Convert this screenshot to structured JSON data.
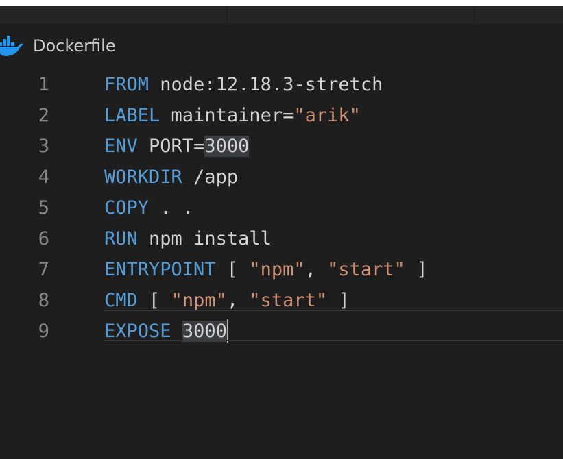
{
  "breadcrumb": {
    "file_name": "Dockerfile",
    "icon": "docker-whale-icon",
    "icon_color": "#2496ed"
  },
  "editor": {
    "lines": [
      {
        "number": "1",
        "parts": [
          {
            "t": "FROM",
            "c": "kw"
          },
          {
            "t": " node:12.18.3-stretch",
            "c": ""
          }
        ]
      },
      {
        "number": "2",
        "parts": [
          {
            "t": "LABEL",
            "c": "kw"
          },
          {
            "t": " maintainer=",
            "c": ""
          },
          {
            "t": "\"arik\"",
            "c": "str"
          }
        ]
      },
      {
        "number": "3",
        "parts": [
          {
            "t": "ENV",
            "c": "kw"
          },
          {
            "t": " PORT=",
            "c": ""
          },
          {
            "t": "3000",
            "c": "hl"
          }
        ]
      },
      {
        "number": "4",
        "parts": [
          {
            "t": "WORKDIR",
            "c": "kw"
          },
          {
            "t": " /app",
            "c": ""
          }
        ]
      },
      {
        "number": "5",
        "parts": [
          {
            "t": "COPY",
            "c": "kw"
          },
          {
            "t": " . .",
            "c": ""
          }
        ]
      },
      {
        "number": "6",
        "parts": [
          {
            "t": "RUN",
            "c": "kw"
          },
          {
            "t": " npm install",
            "c": ""
          }
        ]
      },
      {
        "number": "7",
        "parts": [
          {
            "t": "ENTRYPOINT",
            "c": "kw"
          },
          {
            "t": " [ ",
            "c": ""
          },
          {
            "t": "\"npm\"",
            "c": "str"
          },
          {
            "t": ", ",
            "c": ""
          },
          {
            "t": "\"start\"",
            "c": "str"
          },
          {
            "t": " ]",
            "c": ""
          }
        ]
      },
      {
        "number": "8",
        "parts": [
          {
            "t": "CMD",
            "c": "kw"
          },
          {
            "t": " [ ",
            "c": ""
          },
          {
            "t": "\"npm\"",
            "c": "str"
          },
          {
            "t": ", ",
            "c": ""
          },
          {
            "t": "\"start\"",
            "c": "str"
          },
          {
            "t": " ]",
            "c": ""
          }
        ]
      },
      {
        "number": "9",
        "parts": [
          {
            "t": "EXPOSE",
            "c": "kw"
          },
          {
            "t": " ",
            "c": ""
          },
          {
            "t": "3000",
            "c": "hl"
          }
        ]
      }
    ],
    "cursor_line": "9",
    "colors": {
      "background": "#1e1e1e",
      "keyword": "#569cd6",
      "string": "#ce9178",
      "text": "#d4d4d4",
      "line_number": "#858585",
      "highlight": "#3a3d41"
    }
  }
}
